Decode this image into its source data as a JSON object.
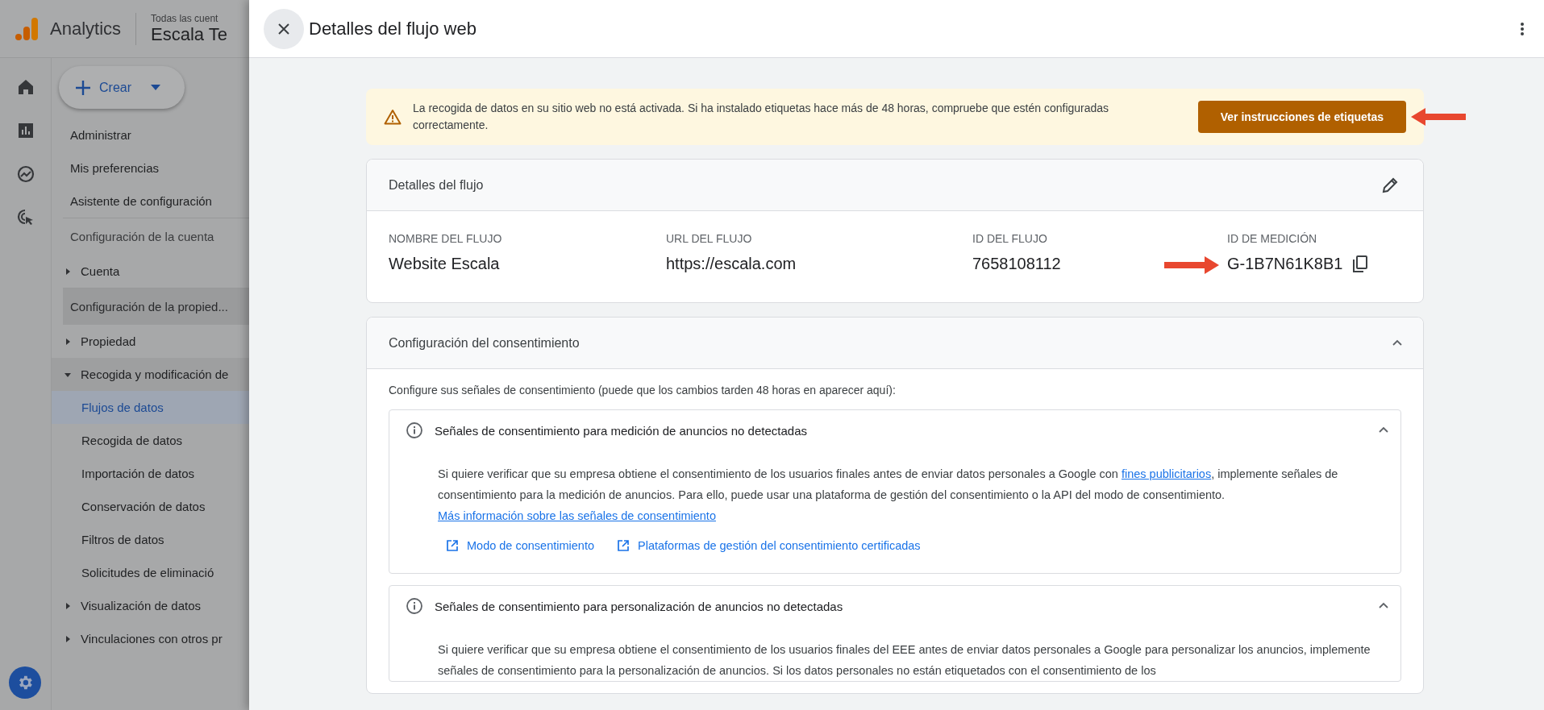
{
  "app": {
    "name": "Analytics",
    "account_path": "Todas las cuent",
    "property": "Escala Te"
  },
  "create_button": {
    "label": "Crear"
  },
  "sidebar": {
    "items": [
      {
        "kind": "link",
        "label": "Administrar"
      },
      {
        "kind": "link",
        "label": "Mis preferencias"
      },
      {
        "kind": "link",
        "label": "Asistente de configuración"
      },
      {
        "kind": "section",
        "label": "Configuración de la cuenta",
        "selected": false
      },
      {
        "kind": "group",
        "label": "Cuenta",
        "expanded": false
      },
      {
        "kind": "section",
        "label": "Configuración de la propied...",
        "selected": true
      },
      {
        "kind": "group",
        "label": "Propiedad",
        "expanded": false
      },
      {
        "kind": "group",
        "label": "Recogida y modificación de",
        "expanded": true,
        "children": [
          {
            "label": "Flujos de datos",
            "selected": true
          },
          {
            "label": "Recogida de datos",
            "selected": false
          },
          {
            "label": "Importación de datos",
            "selected": false
          },
          {
            "label": "Conservación de datos",
            "selected": false
          },
          {
            "label": "Filtros de datos",
            "selected": false
          },
          {
            "label": "Solicitudes de eliminació",
            "selected": false
          }
        ]
      },
      {
        "kind": "group",
        "label": "Visualización de datos",
        "expanded": false
      },
      {
        "kind": "group",
        "label": "Vinculaciones con otros pr",
        "expanded": false
      }
    ]
  },
  "panel": {
    "title": "Detalles del flujo web",
    "banner": {
      "message": "La recogida de datos en su sitio web no está activada. Si ha instalado etiquetas hace más de 48 horas, compruebe que estén configuradas correctamente.",
      "button": "Ver instrucciones de etiquetas"
    },
    "stream_details": {
      "title": "Detalles del flujo",
      "fields": [
        {
          "label": "NOMBRE DEL FLUJO",
          "value": "Website Escala",
          "copyable": false
        },
        {
          "label": "URL DEL FLUJO",
          "value": "https://escala.com",
          "copyable": false
        },
        {
          "label": "ID DEL FLUJO",
          "value": "7658108112",
          "copyable": false
        },
        {
          "label": "ID DE MEDICIÓN",
          "value": "G-1B7N61K8B1",
          "copyable": true
        }
      ]
    },
    "consent": {
      "title": "Configuración del consentimiento",
      "expanded": true,
      "intro": "Configure sus señales de consentimiento (puede que los cambios tarden 48 horas en aparecer aquí):",
      "signals": [
        {
          "title": "Señales de consentimiento para medición de anuncios no detectadas",
          "expanded": true,
          "paragraph": [
            {
              "text": "Si quiere verificar que su empresa obtiene el consentimiento de los usuarios finales antes de enviar datos personales a Google con ",
              "link": false
            },
            {
              "text": "fines publicitarios",
              "link": true
            },
            {
              "text": ", implemente señales de consentimiento para la medición de anuncios. Para ello, puede usar una plataforma de gestión del consentimiento o la API del modo de consentimiento. ",
              "link": false
            },
            {
              "text": "Más información sobre las señales de consentimiento",
              "link": true
            }
          ],
          "links": [
            "Modo de consentimiento",
            "Plataformas de gestión del consentimiento certificadas"
          ]
        },
        {
          "title": "Señales de consentimiento para personalización de anuncios no detectadas",
          "expanded": true,
          "paragraph": [
            {
              "text": "Si quiere verificar que su empresa obtiene el consentimiento de los usuarios finales del EEE antes de enviar datos personales a Google para personalizar los anuncios, implemente señales de consentimiento para la personalización de anuncios. Si los datos personales no están etiquetados con el consentimiento de los",
              "link": false
            }
          ]
        }
      ]
    }
  }
}
